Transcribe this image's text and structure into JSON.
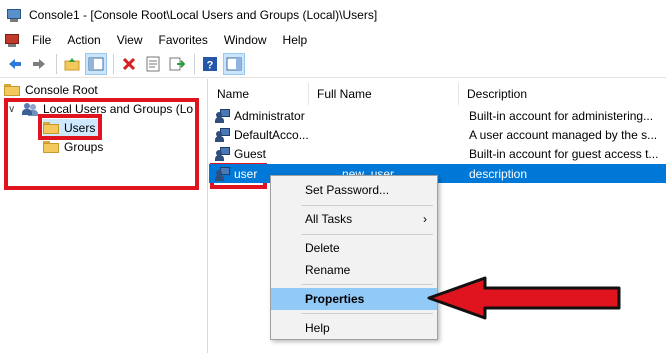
{
  "window": {
    "title": "Console1 - [Console Root\\Local Users and Groups (Local)\\Users]"
  },
  "menubar": {
    "items": [
      "File",
      "Action",
      "View",
      "Favorites",
      "Window",
      "Help"
    ]
  },
  "toolbar": {
    "buttons": [
      "back-icon",
      "forward-icon",
      "up-folder-icon",
      "show-hide-tree-icon",
      "delete-icon",
      "properties-icon",
      "export-list-icon",
      "help-icon",
      "action-pane-icon"
    ]
  },
  "tree": {
    "root": "Console Root",
    "node": "Local Users and Groups (Local)",
    "children": [
      "Users",
      "Groups"
    ]
  },
  "list": {
    "columns": [
      "Name",
      "Full Name",
      "Description"
    ],
    "rows": [
      {
        "name": "Administrator",
        "full_name": "",
        "description": "Built-in account for administering..."
      },
      {
        "name": "DefaultAcco...",
        "full_name": "",
        "description": "A user account managed by the s..."
      },
      {
        "name": "Guest",
        "full_name": "",
        "description": "Built-in account for guest access t..."
      },
      {
        "name": "user",
        "full_name": "new_user",
        "description": "description"
      }
    ]
  },
  "context_menu": {
    "items": [
      "Set Password...",
      "All Tasks",
      "Delete",
      "Rename",
      "Properties",
      "Help"
    ],
    "submenu_arrow": "›"
  },
  "colors": {
    "annotation_red": "#e0141e",
    "selection_blue": "#0078d7",
    "menu_highlight": "#91c9f7"
  }
}
